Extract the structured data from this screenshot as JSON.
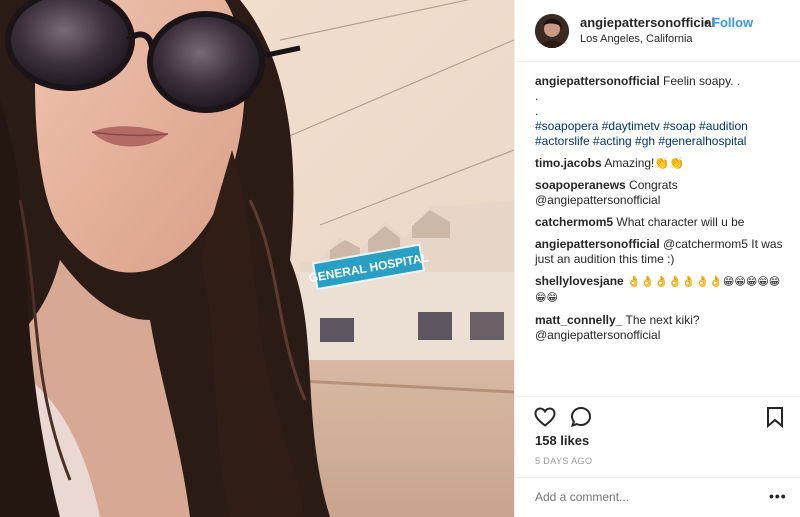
{
  "header": {
    "username": "angiepattersonofficial",
    "separator": "•",
    "follow_label": "Follow",
    "location": "Los Angeles, California"
  },
  "photo": {
    "sign_text": "GENERAL HOSPITAL"
  },
  "caption": {
    "username": "angiepattersonofficial",
    "text": "Feelin soapy. .",
    "line2": ".",
    "line3": ".",
    "hashtags": "#soapopera #daytimetv #soap #audition #actorslife #acting #gh #generalhospital"
  },
  "comments": [
    {
      "username": "timo.jacobs",
      "text": "Amazing!👏👏"
    },
    {
      "username": "soapoperanews",
      "text": "Congrats @angiepattersonofficial"
    },
    {
      "username": "catchermom5",
      "text": "What character will u be"
    },
    {
      "username": "angiepattersonofficial",
      "text": "@catchermom5 It was just an audition this time :)"
    },
    {
      "username": "shellylovesjane",
      "text": "👌👌👌👌👌👌👌😁😁😁😁😁😁😁"
    },
    {
      "username": "matt_connelly_",
      "text": "The next kiki? @angiepattersonofficial"
    }
  ],
  "stats": {
    "likes": "158 likes",
    "time_ago": "5 DAYS AGO"
  },
  "add_comment": {
    "placeholder": "Add a comment..."
  },
  "more_label": "•••",
  "icons": {
    "like": "heart-icon",
    "comment": "comment-icon",
    "save": "bookmark-icon"
  },
  "colors": {
    "link": "#3897f0",
    "hashtag": "#003569",
    "sign": "#2a9fc4"
  }
}
